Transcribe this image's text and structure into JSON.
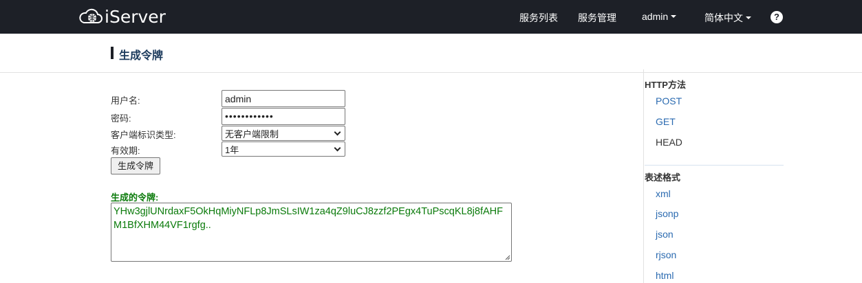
{
  "navbar": {
    "brand": "iServer",
    "items": [
      "服务列表",
      "服务管理"
    ],
    "user": "admin",
    "language": "简体中文",
    "help": "?"
  },
  "page": {
    "title": "生成令牌"
  },
  "form": {
    "username_label": "用户名:",
    "username_value": "admin",
    "password_label": "密码:",
    "password_value": "••••••••••••",
    "client_type_label": "客户端标识类型:",
    "client_type_value": "无客户端限制",
    "validity_label": "有效期:",
    "validity_value": "1年",
    "submit_label": "生成令牌"
  },
  "token": {
    "label": "生成的令牌:",
    "value": "YHw3gjlUNrdaxF5OkHqMiyNFLp8JmSLsIW1za4qZ9luCJ8zzf2PEgx4TuPscqKL8j8fAHFM1BfXHM44VF1rgfg.."
  },
  "sidebar": {
    "http_heading": "HTTP方法",
    "http_methods": [
      "POST",
      "GET",
      "HEAD"
    ],
    "format_heading": "表述格式",
    "formats": [
      "xml",
      "jsonp",
      "json",
      "rjson",
      "html"
    ]
  }
}
